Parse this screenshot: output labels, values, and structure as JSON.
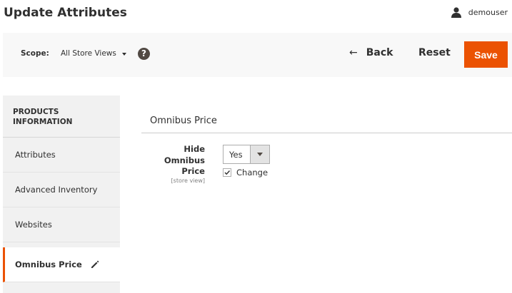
{
  "header": {
    "title": "Update Attributes",
    "username": "demouser"
  },
  "toolbar": {
    "scope_label": "Scope:",
    "scope_value": "All Store Views",
    "help_label": "?",
    "back_label": "Back",
    "back_icon": "←",
    "reset_label": "Reset",
    "save_label": "Save"
  },
  "sidebar": {
    "heading": "PRODUCTS INFORMATION",
    "items": [
      {
        "label": "Attributes"
      },
      {
        "label": "Advanced Inventory"
      },
      {
        "label": "Websites"
      },
      {
        "label": "Omnibus Price"
      }
    ],
    "active_index": 3
  },
  "main": {
    "section_title": "Omnibus Price",
    "field": {
      "label": "Hide Omnibus Price",
      "scope": "[store view]",
      "value": "Yes",
      "change_label": "Change",
      "change_checked": true
    }
  },
  "colors": {
    "accent": "#eb5202",
    "sidebar_bg": "#f1f1f1",
    "toolbar_bg": "#f8f8f8",
    "text": "#303030"
  }
}
